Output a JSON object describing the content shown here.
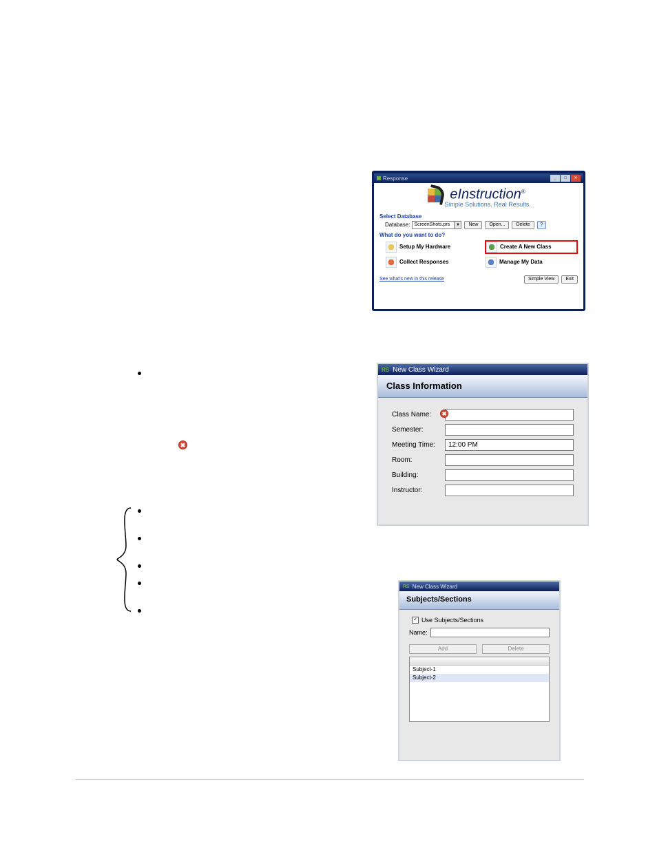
{
  "response_window": {
    "title": "Response",
    "brand": {
      "name": "eInstruction",
      "tagline": "Simple Solutions. Real Results."
    },
    "select_db_label": "Select Database",
    "database_label": "Database:",
    "database_value": "ScreenShots.prs",
    "buttons": {
      "new": "New",
      "open": "Open...",
      "delete": "Delete"
    },
    "what_do_label": "What do you want to do?",
    "actions": {
      "setup_hw": "Setup My Hardware",
      "collect": "Collect Responses",
      "create_class": "Create A New Class",
      "manage_data": "Manage My Data"
    },
    "whats_new": "See what's new in this release",
    "footer_buttons": {
      "simple_view": "Simple View",
      "exit": "Exit"
    }
  },
  "wizard1": {
    "title": "New Class Wizard",
    "header": "Class Information",
    "fields": {
      "class_name": {
        "label": "Class Name:",
        "value": ""
      },
      "semester": {
        "label": "Semester:",
        "value": ""
      },
      "meeting_time": {
        "label": "Meeting Time:",
        "value": "12:00 PM"
      },
      "room": {
        "label": "Room:",
        "value": ""
      },
      "building": {
        "label": "Building:",
        "value": ""
      },
      "instructor": {
        "label": "Instructor:",
        "value": ""
      }
    }
  },
  "wizard2": {
    "title": "New Class Wizard",
    "header": "Subjects/Sections",
    "checkbox_label": "Use Subjects/Sections",
    "name_label": "Name:",
    "add_btn": "Add",
    "delete_btn": "Delete",
    "items": [
      "Subject-1",
      "Subject-2"
    ]
  },
  "icons": {
    "error_glyph": "✖",
    "reg": "®",
    "help": "?",
    "check": "✓"
  }
}
